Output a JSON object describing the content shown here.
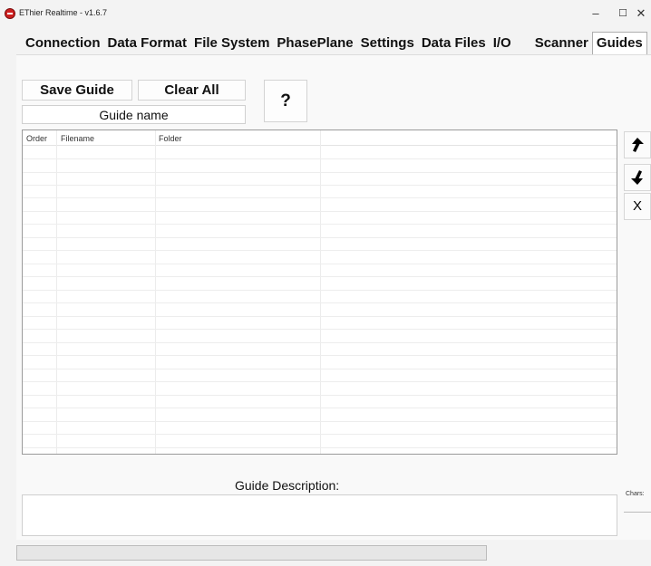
{
  "window": {
    "title": "EThier Realtime - v1.6.7",
    "minimize": "–",
    "maximize": "☐",
    "close": "✕"
  },
  "tabs": [
    {
      "label": "Connection"
    },
    {
      "label": "Data Format"
    },
    {
      "label": "File System"
    },
    {
      "label": "PhasePlane"
    },
    {
      "label": "Settings"
    },
    {
      "label": "Data Files"
    },
    {
      "label": "I/O"
    },
    {
      "label": "Scanner"
    },
    {
      "label": "Guides"
    }
  ],
  "active_tab": "Guides",
  "buttons": {
    "save_guide": "Save Guide",
    "clear_all": "Clear All",
    "help": "?"
  },
  "guide_name": {
    "value": "Guide name"
  },
  "list": {
    "columns": [
      "Order",
      "Filename",
      "Folder",
      ""
    ]
  },
  "side_buttons": {
    "up": "🡅",
    "down": "🡇",
    "remove": "X"
  },
  "description": {
    "label": "Guide Description:",
    "chars_label": "Chars:"
  },
  "colors": {
    "app_icon": "#cc1f1f",
    "panel": "#f9f9f9",
    "border": "#9a9a9a"
  },
  "icons": [
    "app-icon",
    "arrow-up-icon",
    "arrow-down-icon"
  ]
}
